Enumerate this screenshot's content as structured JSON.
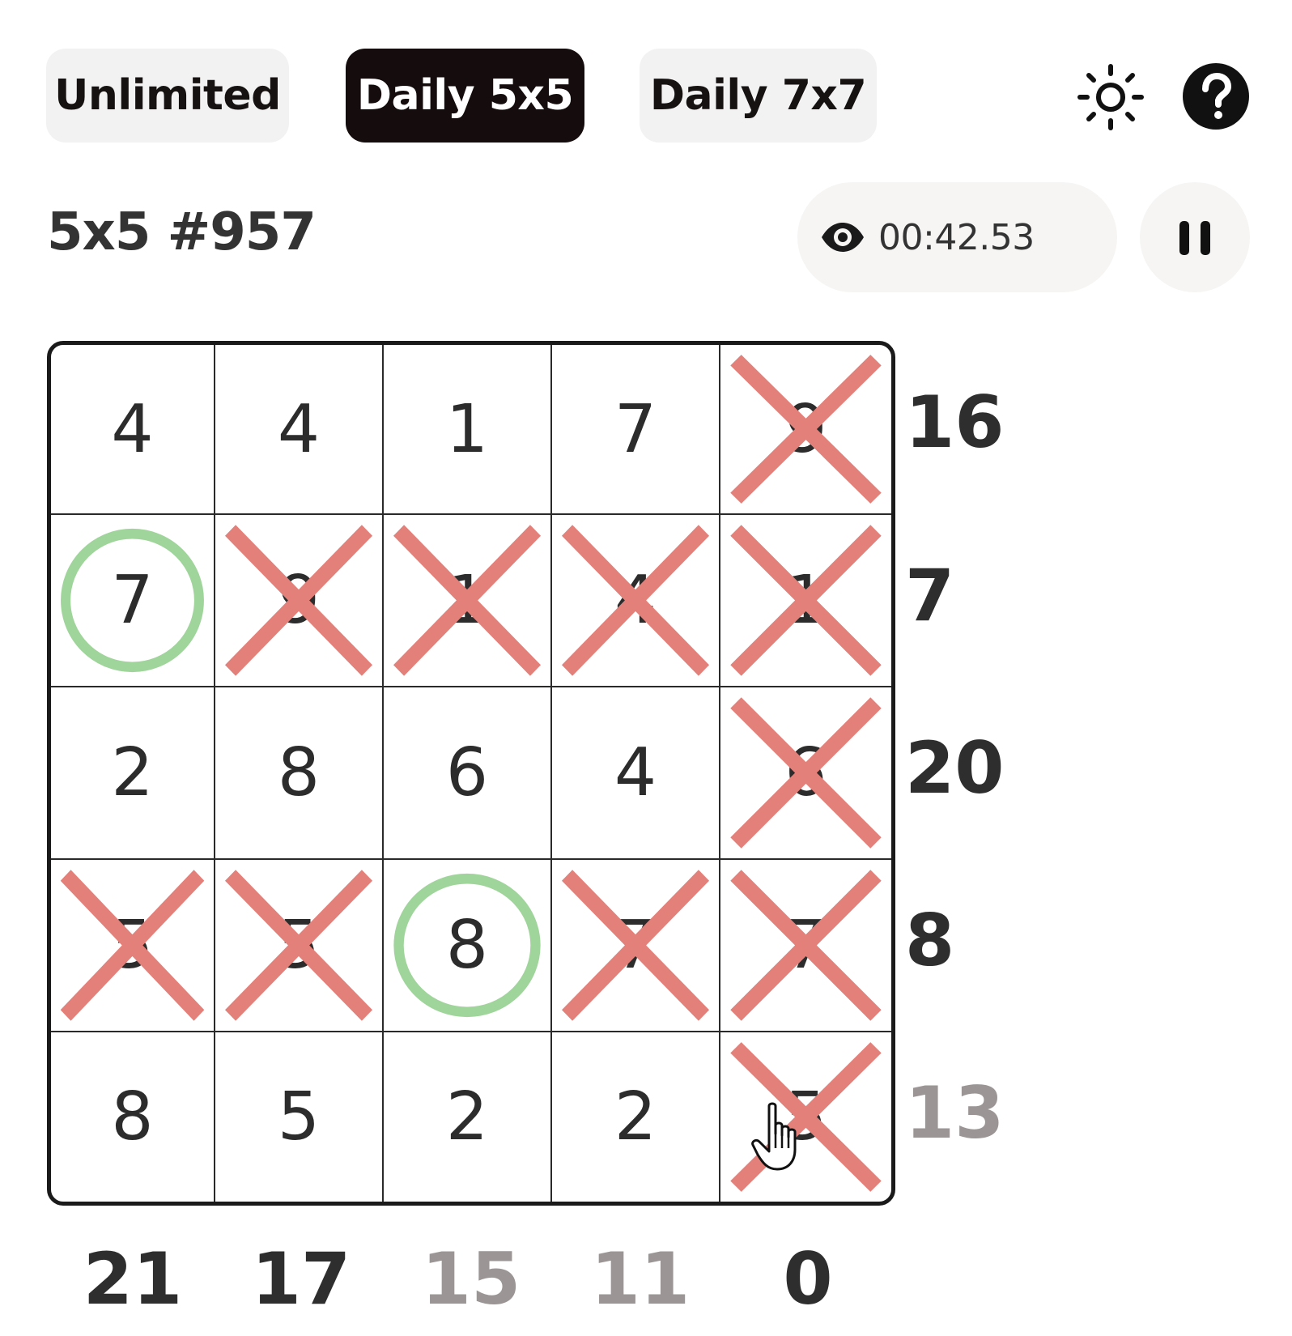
{
  "tabs": [
    {
      "label": "Unlimited",
      "active": false
    },
    {
      "label": "Daily 5x5",
      "active": true
    },
    {
      "label": "Daily 7x7",
      "active": false
    }
  ],
  "icons": {
    "theme": "sun-icon",
    "help": "question-mark-icon",
    "visibility": "eye-icon",
    "pause": "pause-icon"
  },
  "puzzle_title": "5x5 #957",
  "timer": "00:42.53",
  "grid": [
    [
      {
        "v": "4",
        "m": ""
      },
      {
        "v": "4",
        "m": ""
      },
      {
        "v": "1",
        "m": ""
      },
      {
        "v": "7",
        "m": ""
      },
      {
        "v": "9",
        "m": "x"
      }
    ],
    [
      {
        "v": "7",
        "m": "o"
      },
      {
        "v": "9",
        "m": "x"
      },
      {
        "v": "1",
        "m": "x"
      },
      {
        "v": "4",
        "m": "x"
      },
      {
        "v": "1",
        "m": "x"
      }
    ],
    [
      {
        "v": "2",
        "m": ""
      },
      {
        "v": "8",
        "m": ""
      },
      {
        "v": "6",
        "m": ""
      },
      {
        "v": "4",
        "m": ""
      },
      {
        "v": "6",
        "m": "x"
      }
    ],
    [
      {
        "v": "5",
        "m": "x"
      },
      {
        "v": "5",
        "m": "x"
      },
      {
        "v": "8",
        "m": "o"
      },
      {
        "v": "7",
        "m": "x"
      },
      {
        "v": "7",
        "m": "x"
      }
    ],
    [
      {
        "v": "8",
        "m": ""
      },
      {
        "v": "5",
        "m": ""
      },
      {
        "v": "2",
        "m": ""
      },
      {
        "v": "2",
        "m": ""
      },
      {
        "v": "5",
        "m": "x"
      }
    ]
  ],
  "row_sums": [
    {
      "value": "16",
      "dim": false
    },
    {
      "value": "7",
      "dim": false
    },
    {
      "value": "20",
      "dim": false
    },
    {
      "value": "8",
      "dim": false
    },
    {
      "value": "13",
      "dim": true
    }
  ],
  "col_sums": [
    {
      "value": "21",
      "dim": false
    },
    {
      "value": "17",
      "dim": false
    },
    {
      "value": "15",
      "dim": true
    },
    {
      "value": "11",
      "dim": true
    },
    {
      "value": "0",
      "dim": false
    }
  ],
  "colors": {
    "x_mark": "#e4807a",
    "o_mark": "#9fd49b",
    "active_tab": "#150d0d",
    "dim_sum": "#9b9595"
  }
}
